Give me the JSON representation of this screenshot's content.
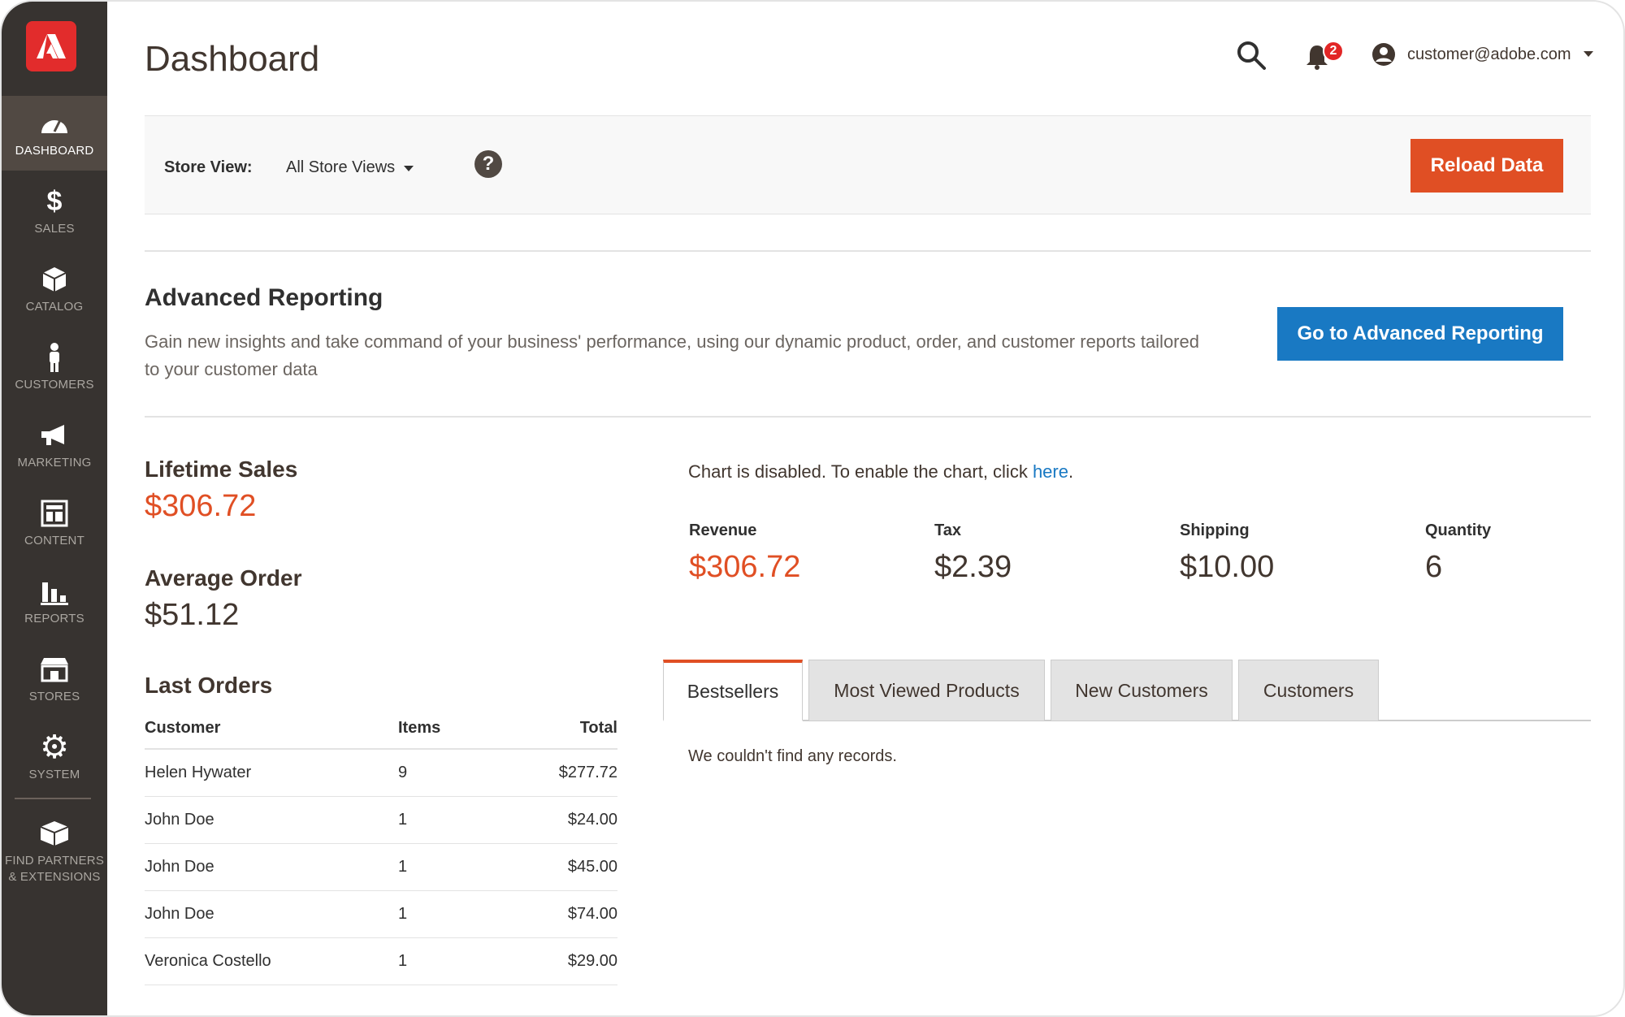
{
  "sidebar": {
    "items": [
      {
        "label": "DASHBOARD",
        "icon": "speedometer-icon",
        "active": true
      },
      {
        "label": "SALES",
        "icon": "dollar-icon"
      },
      {
        "label": "CATALOG",
        "icon": "box-icon"
      },
      {
        "label": "CUSTOMERS",
        "icon": "person-icon"
      },
      {
        "label": "MARKETING",
        "icon": "megaphone-icon"
      },
      {
        "label": "CONTENT",
        "icon": "layout-icon"
      },
      {
        "label": "REPORTS",
        "icon": "bar-chart-icon"
      },
      {
        "label": "STORES",
        "icon": "store-icon"
      },
      {
        "label": "SYSTEM",
        "icon": "gear-icon"
      },
      {
        "label": "FIND PARTNERS & EXTENSIONS",
        "icon": "cube-icon"
      }
    ]
  },
  "header": {
    "title": "Dashboard",
    "notifications_count": "2",
    "user_email": "customer@adobe.com"
  },
  "store_bar": {
    "label": "Store View:",
    "selected": "All Store Views",
    "help": "?",
    "reload_label": "Reload Data"
  },
  "advanced_reporting": {
    "title": "Advanced Reporting",
    "description": "Gain new insights and take command of your business' performance, using our dynamic product, order, and customer reports tailored to your customer data",
    "button_label": "Go to Advanced Reporting"
  },
  "stats": {
    "lifetime_sales_label": "Lifetime Sales",
    "lifetime_sales_value": "$306.72",
    "average_order_label": "Average Order",
    "average_order_value": "$51.12"
  },
  "last_orders": {
    "title": "Last Orders",
    "columns": [
      "Customer",
      "Items",
      "Total"
    ],
    "rows": [
      {
        "customer": "Helen Hywater",
        "items": "9",
        "total": "$277.72"
      },
      {
        "customer": "John Doe",
        "items": "1",
        "total": "$24.00"
      },
      {
        "customer": "John Doe",
        "items": "1",
        "total": "$45.00"
      },
      {
        "customer": "John Doe",
        "items": "1",
        "total": "$74.00"
      },
      {
        "customer": "Veronica Costello",
        "items": "1",
        "total": "$29.00"
      }
    ]
  },
  "chart": {
    "message_prefix": "Chart is disabled. To enable the chart, click ",
    "link_text": "here",
    "message_suffix": "."
  },
  "totals": {
    "revenue_label": "Revenue",
    "revenue_value": "$306.72",
    "tax_label": "Tax",
    "tax_value": "$2.39",
    "shipping_label": "Shipping",
    "shipping_value": "$10.00",
    "quantity_label": "Quantity",
    "quantity_value": "6"
  },
  "tabs": {
    "items": [
      "Bestsellers",
      "Most Viewed Products",
      "New Customers",
      "Customers"
    ],
    "active": "Bestsellers",
    "empty_message": "We couldn't find any records."
  },
  "colors": {
    "accent_orange": "#e04f24",
    "link_blue": "#1979c3",
    "sidebar_bg": "#373330",
    "logo_red": "#e22c2c"
  }
}
